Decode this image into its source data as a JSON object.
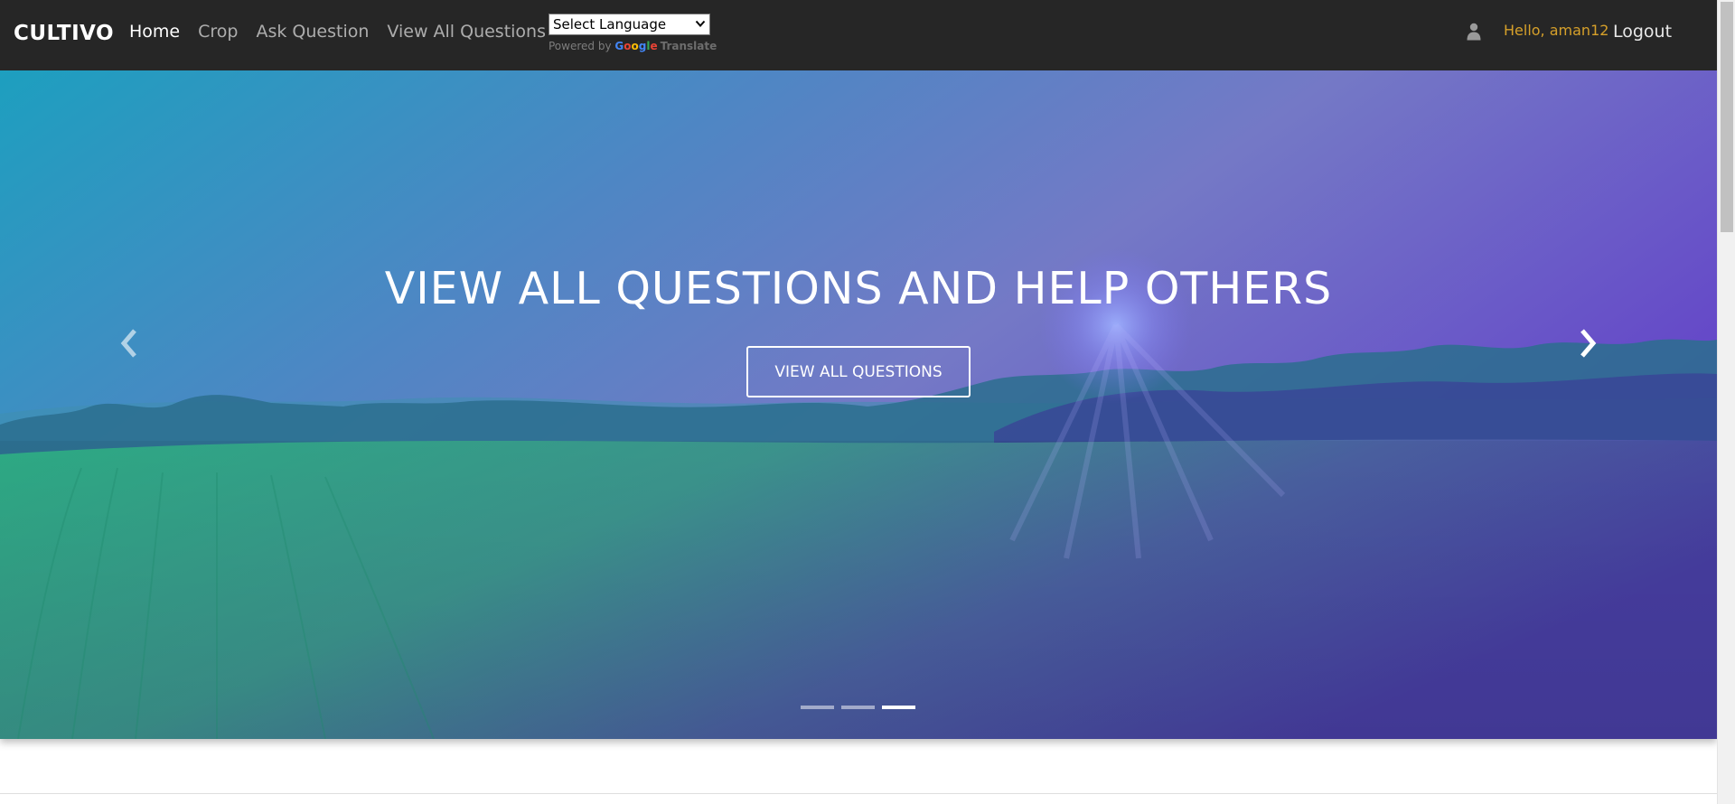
{
  "navbar": {
    "brand": "CULTIVO",
    "links": [
      {
        "label": "Home",
        "active": true
      },
      {
        "label": "Crop",
        "active": false
      },
      {
        "label": "Ask Question",
        "active": false
      },
      {
        "label": "View All Questions",
        "active": false
      }
    ],
    "translate": {
      "selected": "Select Language",
      "powered_by": "Powered by",
      "google_letters": [
        "G",
        "o",
        "o",
        "g",
        "l",
        "e"
      ],
      "translate_word": "Translate"
    },
    "user_icon": "user-icon",
    "greeting": "Hello, aman12",
    "logout_label": "Logout"
  },
  "hero": {
    "title": "VIEW ALL QUESTIONS AND HELP OTHERS",
    "button_label": "VIEW ALL QUESTIONS",
    "prev_icon": "chevron-left-icon",
    "next_icon": "chevron-right-icon",
    "slide_count": 3,
    "active_slide": 3
  },
  "colors": {
    "navbar_bg": "#262626",
    "greeting": "#d6a02a",
    "gradient_left": "#21b49a",
    "gradient_right": "#6a3fd0"
  }
}
